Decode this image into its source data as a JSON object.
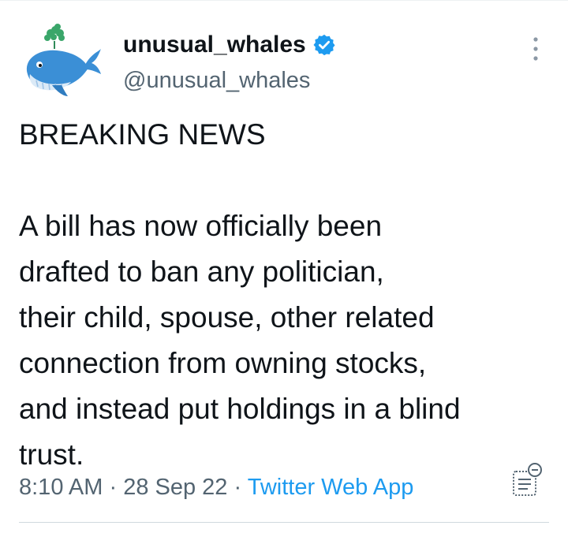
{
  "author": {
    "display_name": "unusual_whales",
    "handle": "@unusual_whales",
    "avatar_icon": "whale-logo-icon",
    "verified_icon": "verified-badge-icon"
  },
  "tweet": {
    "headline": "BREAKING NEWS",
    "body_lines": [
      "A bill has now officially been",
      "drafted to ban any politician,",
      "their child, spouse, other related",
      "connection from owning stocks,",
      "and instead put holdings in a blind",
      "trust."
    ]
  },
  "meta": {
    "time": "8:10 AM",
    "separator": "·",
    "date": "28 Sep 22",
    "source": "Twitter Web App"
  },
  "icons": {
    "more": "more-options-icon",
    "analytics": "tweet-analytics-icon"
  },
  "colors": {
    "text": "#0f1419",
    "secondary": "#536471",
    "accent": "#1d9bf0",
    "whale_blue": "#3b8fd6",
    "leaf_green": "#3aa66a"
  }
}
